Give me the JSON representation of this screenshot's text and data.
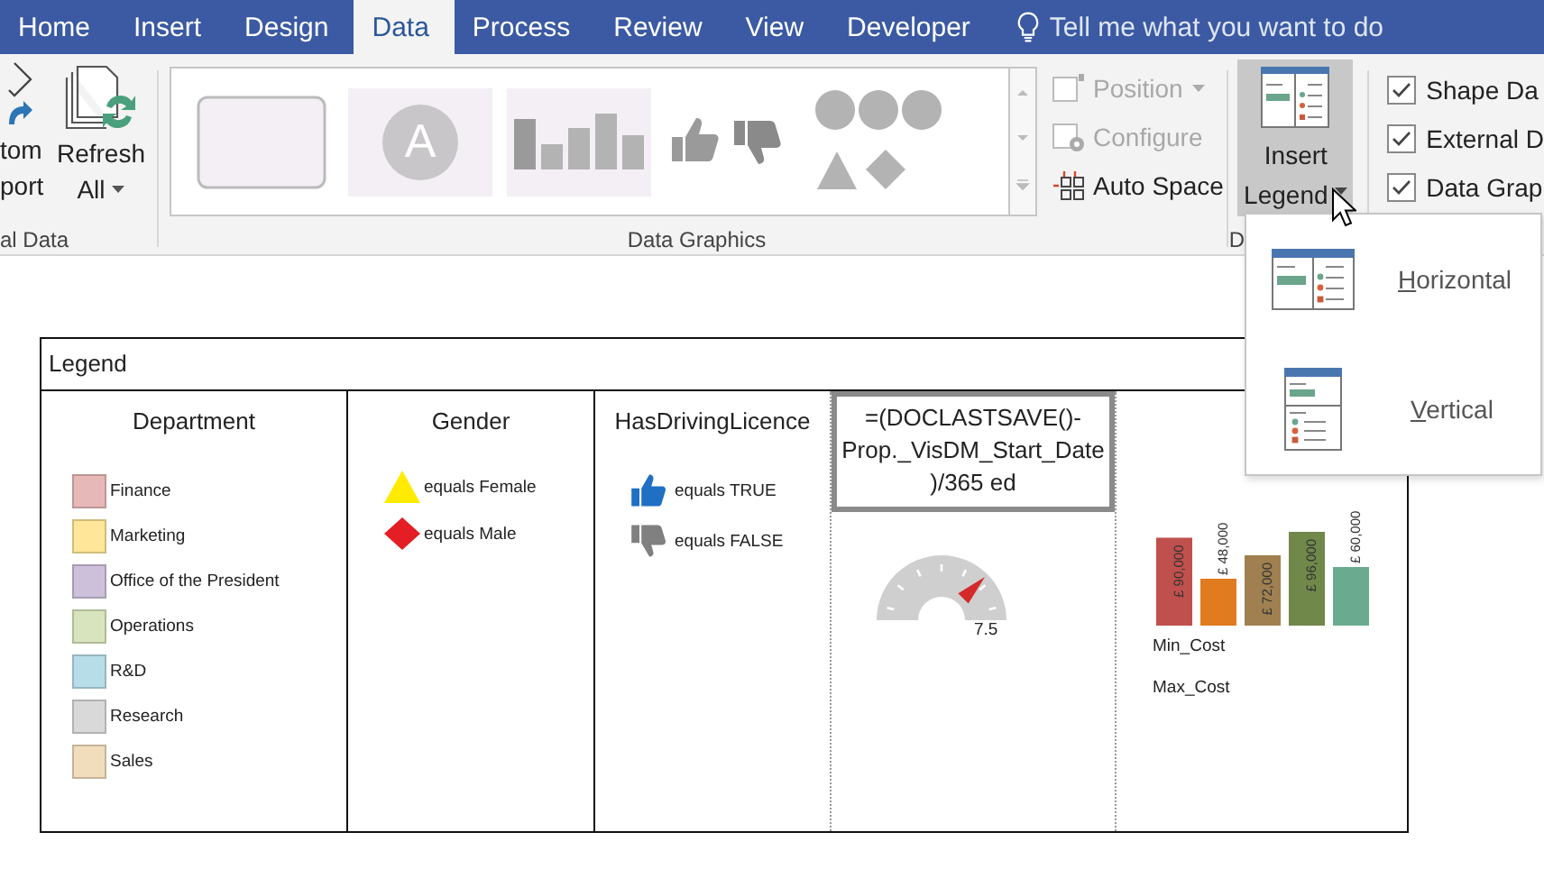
{
  "tabs": [
    {
      "label": "Home",
      "selected": false
    },
    {
      "label": "Insert",
      "selected": false
    },
    {
      "label": "Design",
      "selected": false
    },
    {
      "label": "Data",
      "selected": true
    },
    {
      "label": "Process",
      "selected": false
    },
    {
      "label": "Review",
      "selected": false
    },
    {
      "label": "View",
      "selected": false
    },
    {
      "label": "Developer",
      "selected": false
    }
  ],
  "tell_me": {
    "placeholder": "Tell me what you want to do"
  },
  "ribbon": {
    "external_data": {
      "buttons": [
        {
          "kind": "import",
          "lines": [
            "tom",
            "port"
          ]
        },
        {
          "kind": "refresh",
          "lines": [
            "Refresh",
            "All"
          ],
          "dropdown": true
        }
      ],
      "group_label": "al Data"
    },
    "data_graphics": {
      "gallery": [
        {
          "kind": "callout"
        },
        {
          "kind": "badge",
          "text": "A"
        },
        {
          "kind": "bars"
        },
        {
          "kind": "thumbs"
        },
        {
          "kind": "shapes"
        }
      ],
      "commands": [
        {
          "kind": "position",
          "label": "Position",
          "disabled": true,
          "dropdown": true
        },
        {
          "kind": "configure",
          "label": "Configure",
          "disabled": true,
          "dropdown": false
        },
        {
          "kind": "autospace",
          "label": "Auto Space",
          "disabled": false,
          "dropdown": false
        }
      ],
      "group_label": "Data Graphics"
    },
    "insert_legend": {
      "lines": [
        "Insert",
        "Legend"
      ],
      "expanded": true,
      "group_label": "D"
    },
    "show": [
      {
        "label": "Shape Da",
        "checked": true
      },
      {
        "label": "External D",
        "checked": true
      },
      {
        "label": "Data Grap",
        "checked": true
      }
    ]
  },
  "legend_menu": [
    {
      "kind": "horizontal",
      "label": "Horizontal"
    },
    {
      "kind": "vertical",
      "label": "Vertical"
    }
  ],
  "legend": {
    "title": "Legend",
    "columns": [
      {
        "kind": "swatches",
        "heading": "Department",
        "items": [
          {
            "label": "Finance",
            "color": "#e6b9b8"
          },
          {
            "label": "Marketing",
            "color": "#ffe699"
          },
          {
            "label": "Office of the President",
            "color": "#ccc0da"
          },
          {
            "label": "Operations",
            "color": "#d7e4bd"
          },
          {
            "label": "R&D",
            "color": "#b7dee8"
          },
          {
            "label": "Research",
            "color": "#d9d9d9"
          },
          {
            "label": "Sales",
            "color": "#f1dcbc"
          }
        ]
      },
      {
        "kind": "symbols",
        "heading": "Gender",
        "items": [
          {
            "kind": "triangle",
            "label": "equals Female",
            "color": "#ffeb00"
          },
          {
            "kind": "diamond",
            "label": "equals Male",
            "color": "#e31e24"
          }
        ]
      },
      {
        "kind": "icons",
        "heading": "HasDrivingLicence",
        "items": [
          {
            "kind": "thumb_up",
            "label": "equals TRUE",
            "color": "#1f6fc5"
          },
          {
            "kind": "thumb_down",
            "label": "equals FALSE",
            "color": "#808080"
          }
        ]
      },
      {
        "kind": "formula",
        "formula": "=(DOCLASTSAVE()-Prop._VisDM_Start_Date)/365 ed",
        "gauge": {
          "level": 0.75,
          "reading": "7.5"
        }
      },
      {
        "kind": "bars",
        "chart_data": {
          "type": "bar",
          "values": [
            90000,
            48000,
            72000,
            96000,
            60000
          ],
          "value_labels": [
            "£ 90,000",
            "£ 48,000",
            "£ 72,000",
            "£ 96,000",
            "£ 60,000"
          ],
          "colors": [
            "#c0504d",
            "#e07b1f",
            "#a08050",
            "#70884a",
            "#6aaa8e"
          ]
        },
        "labels": [
          "Min_Cost",
          "Max_Cost"
        ]
      }
    ]
  }
}
